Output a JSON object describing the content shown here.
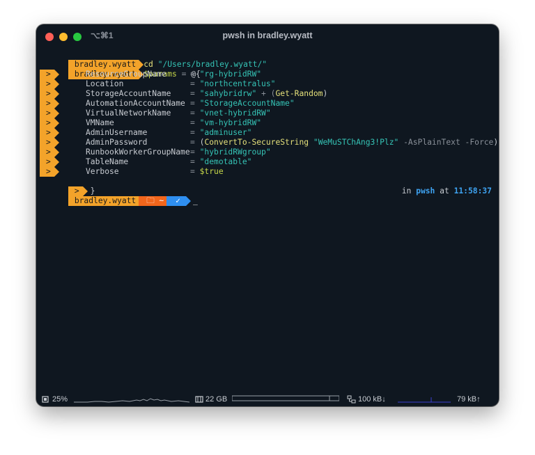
{
  "window": {
    "title": "pwsh in bradley.wyatt",
    "shortcut": "⌥⌘1"
  },
  "prompt": {
    "user": "bradley.wyatt",
    "cont": ">",
    "path": "~",
    "ok": "✓"
  },
  "lines": {
    "cmd1_kw": "cd",
    "cmd1_arg": "\"/Users/bradley.wyatt/\"",
    "cmd2_var": "$params",
    "cmd2_op": " = ",
    "cmd2_open": "@{",
    "close": "}",
    "cursor": "_"
  },
  "params": [
    {
      "key": "ResourceGroupName",
      "value": "\"rg-hybridRW\""
    },
    {
      "key": "Location",
      "value": "\"northcentralus\""
    },
    {
      "key": "StorageAccountName",
      "value": "\"sahybridrw\"",
      "extra_op": " + (",
      "extra_fn": "Get-Random",
      "extra_close": ")"
    },
    {
      "key": "AutomationAccountName",
      "value": "\"StorageAccountName\""
    },
    {
      "key": "VirtualNetworkName",
      "value": "\"vnet-hybridRW\""
    },
    {
      "key": "VMName",
      "value": "\"vm-hybridRW\""
    },
    {
      "key": "AdminUsername",
      "value": "\"adminuser\""
    },
    {
      "key": "AdminPassword",
      "value": "\"WeMuSTChAng3!Plz\"",
      "pre": "(",
      "fn": "ConvertTo-SecureString",
      "post_params": " -AsPlainText -Force",
      "post": ")"
    },
    {
      "key": "RunbookWorkerGroupName",
      "value": "\"hybridRWgroup\""
    },
    {
      "key": "TableName",
      "value": "\"demotable\""
    },
    {
      "key": "Verbose",
      "value": "$true"
    }
  ],
  "eq": "=",
  "right_prompt": {
    "in": "in ",
    "shell": "pwsh",
    "at": " at ",
    "time": "11:58:37"
  },
  "statusbar": {
    "cpu": "25%",
    "mem": "22 GB",
    "net_down": "100 kB↓",
    "net_up": "79 kB↑",
    "cpu_icon": "cpu-icon",
    "mem_icon": "memory-icon",
    "net_icon": "network-icon"
  },
  "colors": {
    "background": "#0f1720",
    "prompt_user": "#f3a32a",
    "prompt_path": "#f2661c",
    "prompt_ok": "#2f8ff0",
    "string": "#35c3b5",
    "command": "#e5e07a"
  }
}
